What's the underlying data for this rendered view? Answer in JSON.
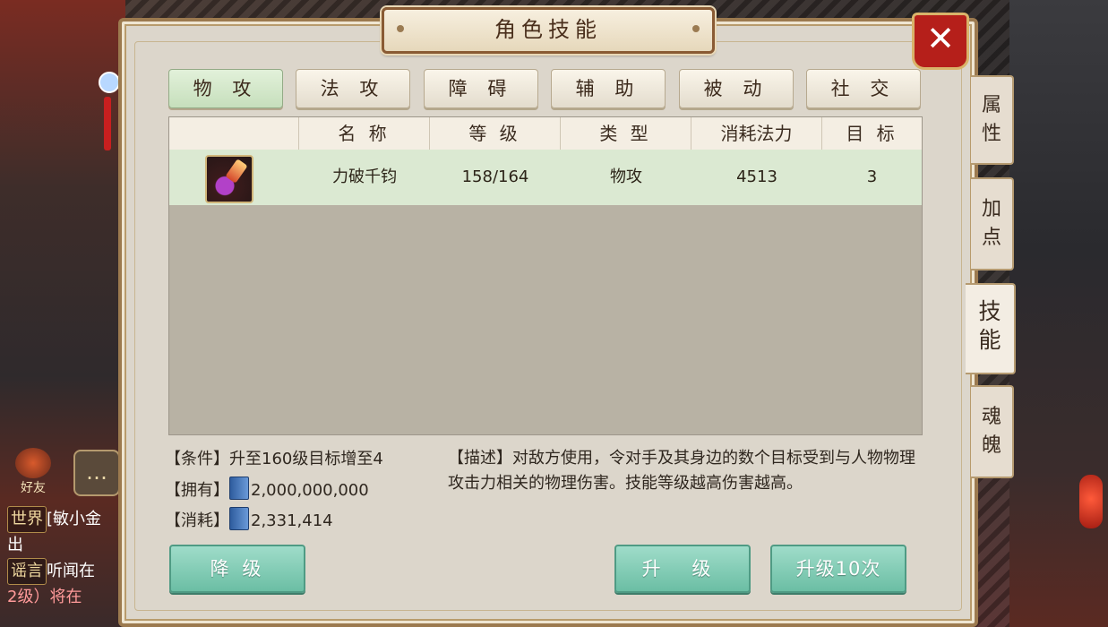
{
  "window": {
    "title": "角色技能",
    "close_icon": "close-icon"
  },
  "tabs": [
    {
      "label": "物 攻",
      "active": true
    },
    {
      "label": "法 攻",
      "active": false
    },
    {
      "label": "障 碍",
      "active": false
    },
    {
      "label": "辅 助",
      "active": false
    },
    {
      "label": "被 动",
      "active": false
    },
    {
      "label": "社 交",
      "active": false
    }
  ],
  "table": {
    "headers": [
      "",
      "名 称",
      "等 级",
      "类 型",
      "消耗法力",
      "目 标"
    ],
    "rows": [
      {
        "icon": "skill-icon",
        "name": "力破千钧",
        "level": "158/164",
        "type": "物攻",
        "mana_cost": "4513",
        "targets": "3"
      }
    ]
  },
  "info": {
    "condition_label": "【条件】",
    "condition_text": "升至160级目标增至4",
    "owned_label": "【拥有】",
    "owned_value": "2,000,000,000",
    "cost_label": "【消耗】",
    "cost_value": "2,331,414",
    "description_label": "【描述】",
    "description_text": "对敌方使用，令对手及其身边的数个目标受到与人物物理攻击力相关的物理伤害。技能等级越高伤害越高。"
  },
  "buttons": {
    "downgrade": "降 级",
    "upgrade": "升 级",
    "upgrade10": "升级10次"
  },
  "side_tabs": [
    {
      "label": "属\n性",
      "active": false
    },
    {
      "label": "加\n点",
      "active": false
    },
    {
      "label": "技\n能",
      "active": true
    },
    {
      "label": "魂\n魄",
      "active": false
    }
  ],
  "chat": {
    "friend_label": "好友",
    "line1_tag": "世界",
    "line1_text": "[敏小金",
    "line2_text": "出",
    "line3_tag": "谣言",
    "line3_text": "听闻在",
    "line4_text": "2级）将在"
  },
  "colors": {
    "panel_bg": "#dcd6cb",
    "active_tab": "#c6dfbc",
    "button": "#6bbea4",
    "close": "#b51f1a"
  }
}
